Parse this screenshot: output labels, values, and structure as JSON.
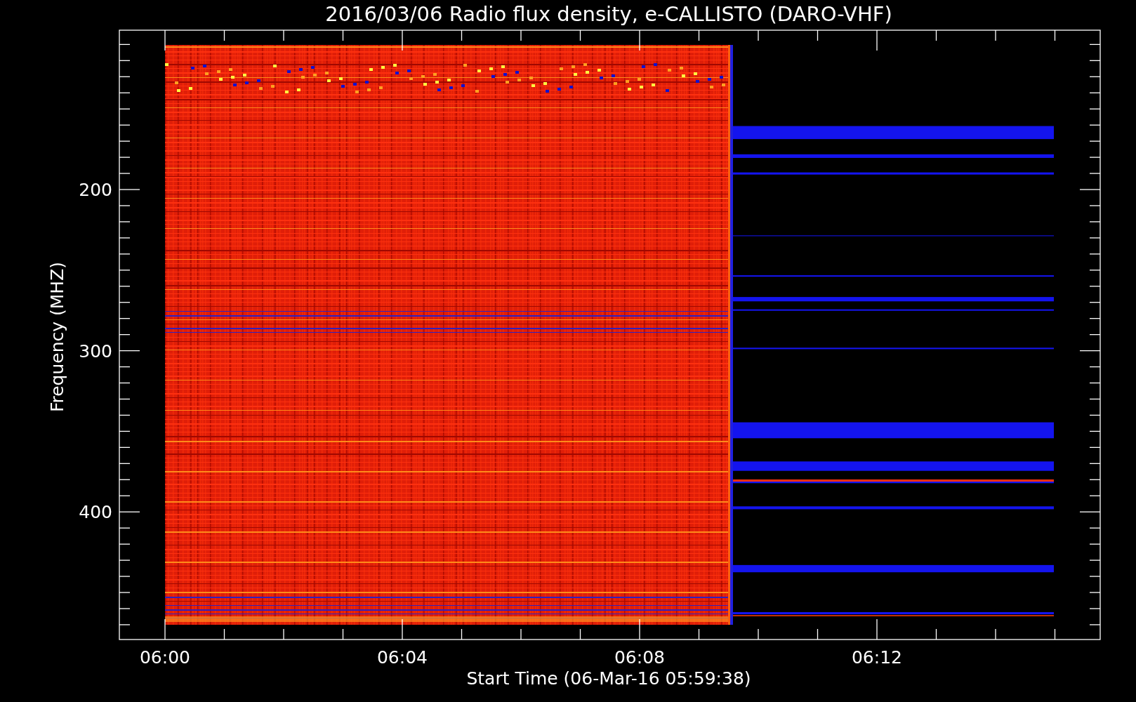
{
  "title": "2016/03/06  Radio flux density, e-CALLISTO (DARO-VHF)",
  "y_axis": {
    "label": "Frequency (MHZ)",
    "ticks": [
      "200",
      "300",
      "400"
    ]
  },
  "x_axis": {
    "label": "Start Time (06-Mar-16 05:59:38)",
    "ticks": [
      "06:00",
      "06:04",
      "06:08",
      "06:12"
    ]
  }
}
